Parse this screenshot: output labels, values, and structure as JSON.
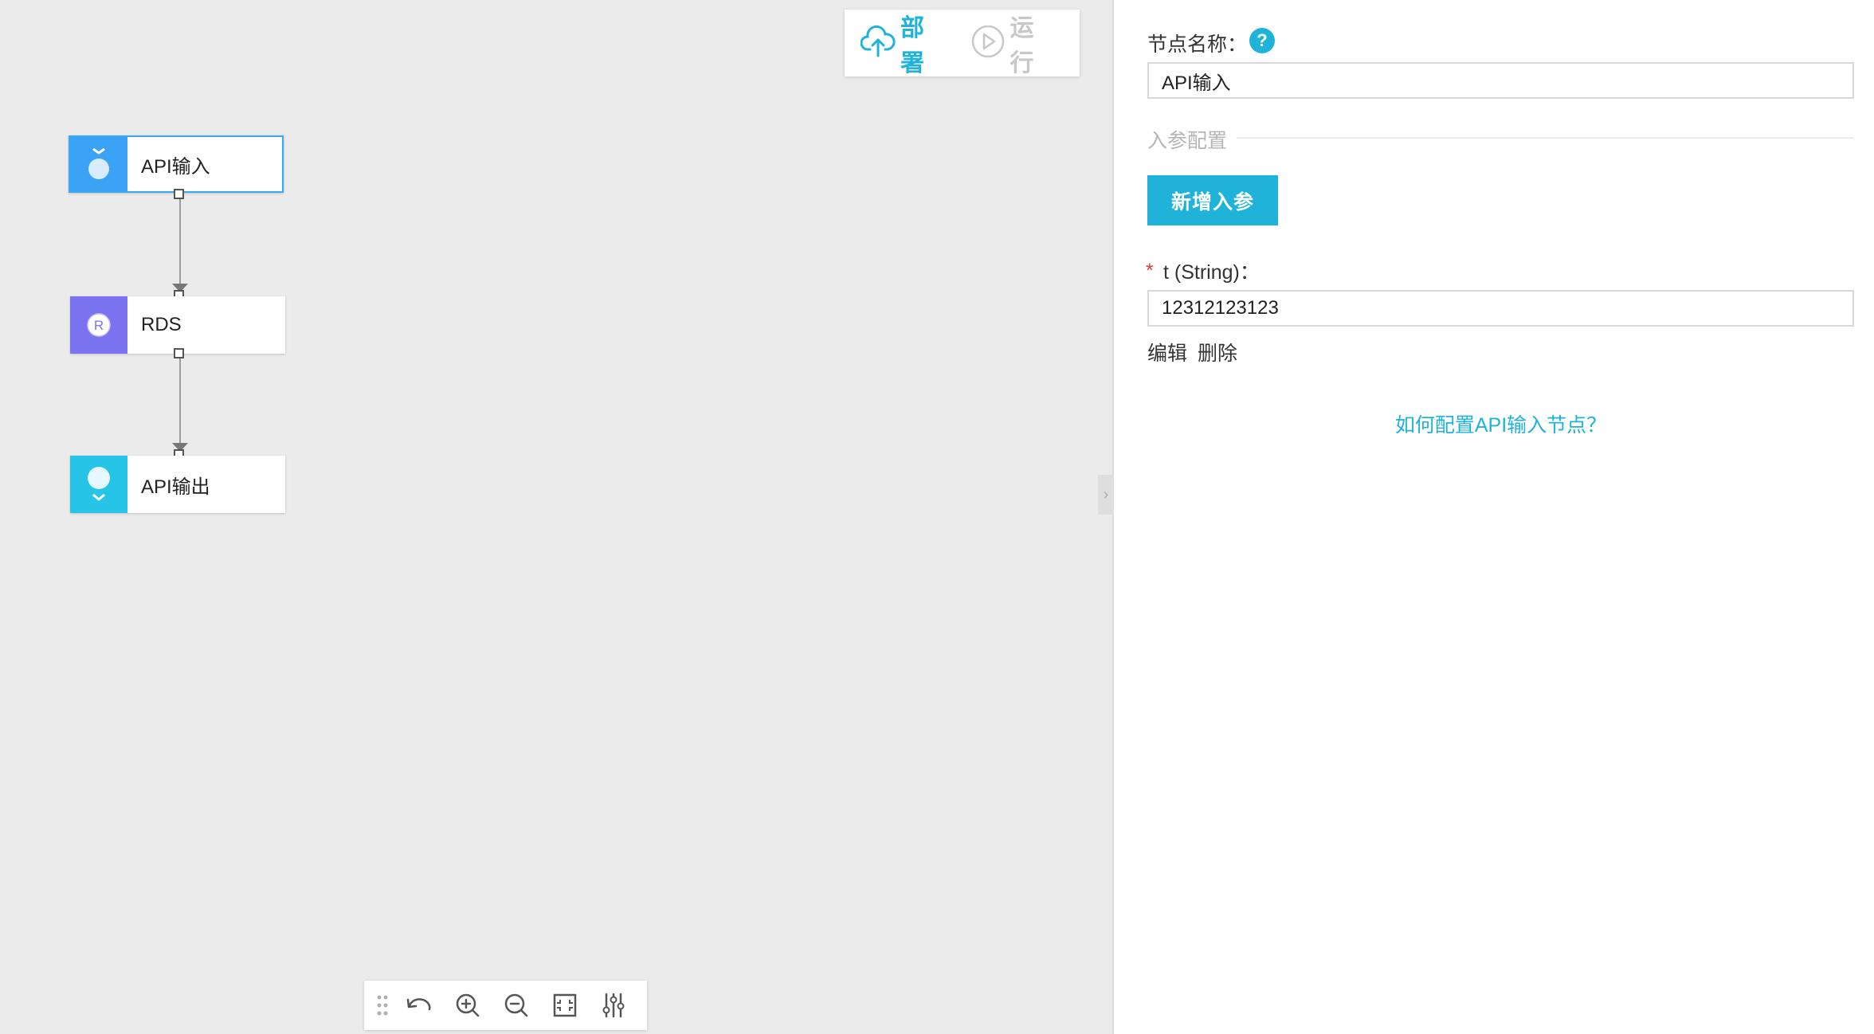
{
  "toolbar": {
    "deploy_label": "部署",
    "run_label": "运行"
  },
  "flow": {
    "nodes": [
      {
        "label": "API输入",
        "icon": "api-input-icon",
        "color": "#3aa3f5",
        "selected": true
      },
      {
        "label": "RDS",
        "icon": "rds-icon",
        "color": "#7b73f0",
        "icon_letter": "R"
      },
      {
        "label": "API输出",
        "icon": "api-output-icon",
        "color": "#26c4e6"
      }
    ]
  },
  "canvas_tools": [
    "drag-handle-icon",
    "undo-icon",
    "zoom-in-icon",
    "zoom-out-icon",
    "fit-view-icon",
    "settings-sliders-icon"
  ],
  "panel": {
    "node_name_label": "节点名称：",
    "node_name_value": "API输入",
    "section_title": "入参配置",
    "add_param_label": "新增入参",
    "param_label": "t (String)：",
    "param_value": "12312123123",
    "edit_label": "编辑",
    "delete_label": "删除",
    "help_link": "如何配置API输入节点？"
  },
  "colors": {
    "accent": "#1fb3d9",
    "canvas_bg": "#ebebeb",
    "required": "#e03c3c"
  }
}
